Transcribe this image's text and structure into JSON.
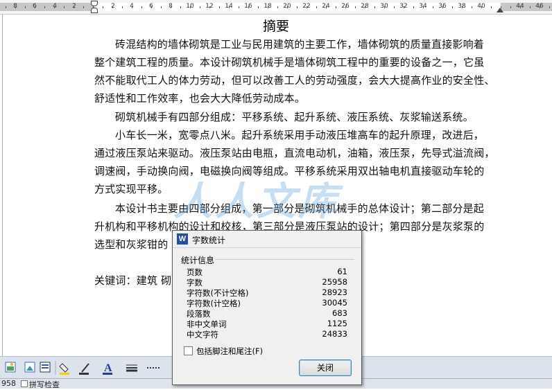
{
  "ruler": {
    "numbers": [
      "8",
      "6",
      "4",
      "2",
      "2",
      "4",
      "6",
      "8",
      "10",
      "12",
      "14",
      "16",
      "18",
      "20",
      "22",
      "24",
      "26",
      "28",
      "30",
      "32",
      "34",
      "36",
      "38",
      "40",
      "44",
      "46"
    ]
  },
  "document": {
    "title": "摘要",
    "lines": [
      "砖混结构的墙体砌筑是工业与民用建筑的主要工作，墙体砌筑的质量直接影响着",
      "整个建筑工程的质量。本设计砌筑机械手是墙体砌筑工程中的重要的设备之一，它虽",
      "然不能取代工人的体力劳动，但可以改善工人的劳动强度，会大大提高作业的安全性、",
      "舒适性和工作效率，也会大大降低劳动成本。",
      "砌筑机械手有四部分组成：平移系统、起升系统、液压系统、灰浆输送系统。",
      "小车长一米，宽零点八米。起升系统采用手动液压堆高车的起升原理，改进后，",
      "通过液压泵站来驱动。液压泵站由电瓶，直流电动机，油箱，液压泵，先导式溢流阀，",
      "调速阀，手动换向阀，电磁换向阀等组成。平移系统采用双出轴电机直接驱动车轮的",
      "方式实现平移。",
      "本设计书主要由四部分组成，第一部分是砌筑机械手的总体设计；第二部分是起",
      "升机构和平移机构的设计和校核，第三部分是液压泵站的设计；第四部分是灰浆泵的",
      "选型和灰浆钳的"
    ],
    "keywords": "关键词：建筑  砌"
  },
  "watermark": "人人文库",
  "statusbar": {
    "count": "958",
    "spell": "拼写检查"
  },
  "dialog": {
    "title": "字数统计",
    "group": "统计信息",
    "stats": [
      {
        "label": "页数",
        "value": "61"
      },
      {
        "label": "字数",
        "value": "25958"
      },
      {
        "label": "字符数(不计空格)",
        "value": "28923"
      },
      {
        "label": "字符数(计空格)",
        "value": "30045"
      },
      {
        "label": "段落数",
        "value": "683"
      },
      {
        "label": "非中文单词",
        "value": "1125"
      },
      {
        "label": "中文字符",
        "value": "24833"
      }
    ],
    "checkbox_label": "包括脚注和尾注(F)",
    "checkbox_checked": false,
    "close_label": "关闭"
  }
}
